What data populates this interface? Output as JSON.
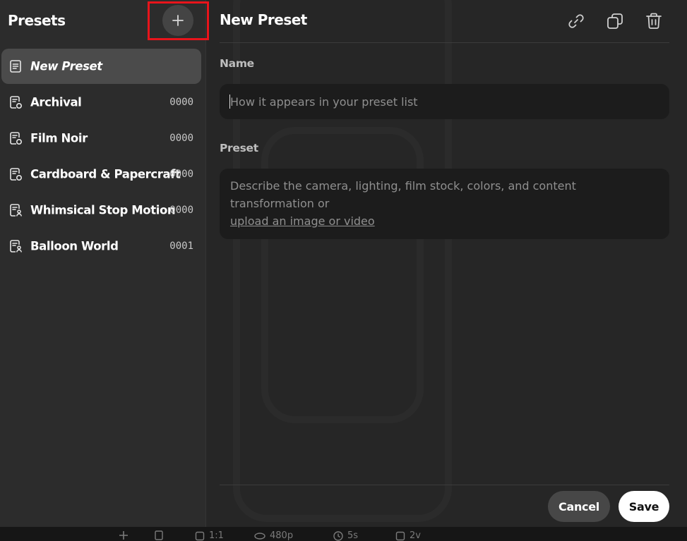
{
  "sidebar": {
    "title": "Presets",
    "add_icon": "plus-icon",
    "items": [
      {
        "label": "New Preset",
        "count": "",
        "icon": "preset-file-icon",
        "active": true
      },
      {
        "label": "Archival",
        "count": "0000",
        "icon": "preset-camera-icon"
      },
      {
        "label": "Film Noir",
        "count": "0000",
        "icon": "preset-camera-icon"
      },
      {
        "label": "Cardboard & Papercraft",
        "count": "0000",
        "icon": "preset-camera-icon"
      },
      {
        "label": "Whimsical Stop Motion",
        "count": "0000",
        "icon": "preset-person-icon"
      },
      {
        "label": "Balloon World",
        "count": "0001",
        "icon": "preset-person-icon"
      }
    ]
  },
  "main": {
    "title": "New Preset",
    "actions": [
      "link-icon",
      "duplicate-icon",
      "trash-icon"
    ],
    "name_label": "Name",
    "name_placeholder": "How it appears in your preset list",
    "name_value": "",
    "preset_label": "Preset",
    "preset_placeholder": "Describe the camera, lighting, film stock, colors, and content transformation or",
    "preset_upload_link": "upload an image or video",
    "cancel_label": "Cancel",
    "save_label": "Save"
  },
  "toolbar": {
    "aspect": "1:1",
    "resolution": "480p",
    "duration": "5s",
    "variations": "2v"
  },
  "colors": {
    "highlight": "#e8141b",
    "save_bg": "#ffffff",
    "active_item": "#4b4b4b"
  }
}
